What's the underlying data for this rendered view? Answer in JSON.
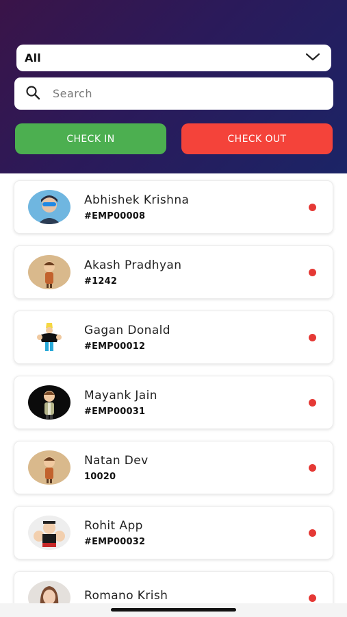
{
  "filter": {
    "selected": "All"
  },
  "search": {
    "placeholder": "Search",
    "value": ""
  },
  "actions": {
    "check_in": "CHECK IN",
    "check_out": "CHECK OUT"
  },
  "colors": {
    "check_in": "#4caf50",
    "check_out": "#f4433a",
    "status_dot": "#e53935",
    "header_gradient_start": "#3a1448",
    "header_gradient_end": "#1b2466"
  },
  "employees": [
    {
      "name": "Abhishek Krishna",
      "code": "#EMP00008",
      "status": "red-dot"
    },
    {
      "name": "Akash Pradhyan",
      "code": "#1242",
      "status": "red-dot"
    },
    {
      "name": "Gagan Donald",
      "code": "#EMP00012",
      "status": "red-dot"
    },
    {
      "name": "Mayank Jain",
      "code": "#EMP00031",
      "status": "red-dot"
    },
    {
      "name": "Natan Dev",
      "code": "10020",
      "status": "red-dot"
    },
    {
      "name": "Rohit App",
      "code": "#EMP00032",
      "status": "red-dot"
    },
    {
      "name": "Romano Krish",
      "code": "",
      "status": "red-dot"
    }
  ]
}
